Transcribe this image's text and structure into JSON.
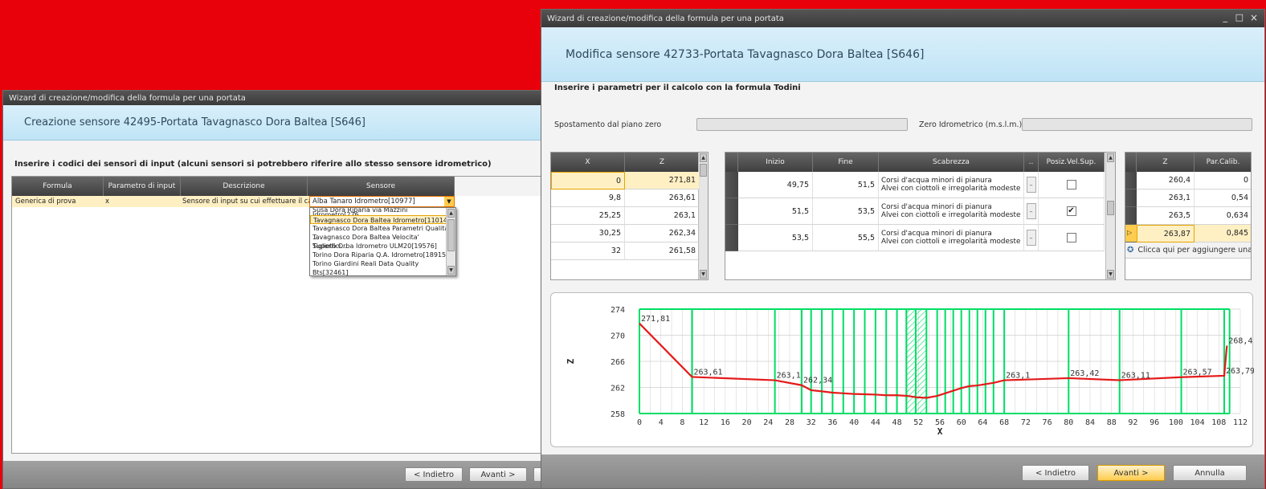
{
  "left": {
    "title": "Wizard di creazione/modifica della formula per una portata",
    "header": "Creazione sensore 42495-Portata Tavagnasco Dora Baltea [S646]",
    "instruction": "Inserire i codici dei sensori di input (alcuni sensori si potrebbero riferire allo stesso sensore idrometrico)",
    "columns": [
      "Formula",
      "Parametro di input",
      "Descrizione",
      "Sensore"
    ],
    "row": [
      "Generica di prova",
      "x",
      "Sensore di input su cui effettuare il calcolo",
      "Alba Tanaro Idrometro[10977]"
    ],
    "dropdown": [
      "Susa Dora Riparia via Mazzini Idrometro[276...",
      "Tavagnasco Dora Baltea Idrometro[11014]",
      "Tavagnasco Dora Baltea Parametri Qualita' ...",
      "Tavagnasco Dora Baltea Velocita' Superfici...",
      "Tiglieto Orba Idrometro ULM20[19576]",
      "Torino Dora Riparia Q.A. Idrometro[18915]",
      "Torino Giardini Reali Data Quality Bts[32461]"
    ],
    "back": "< Indietro",
    "next": "Avanti >"
  },
  "right": {
    "title": "Wizard di creazione/modifica della formula per una portata",
    "controls": [
      "_",
      "□",
      "×"
    ],
    "header": "Modifica sensore 42733-Portata Tavagnasco Dora Baltea [S646]",
    "instruction": "Inserire i parametri per il calcolo con la formula Todini",
    "offset_label": "Spostamento dal piano zero",
    "zero_label": "Zero Idrometrico (m.s.l.m.)",
    "xz": {
      "columns": [
        "X",
        "Z"
      ],
      "rows": [
        [
          "0",
          "271,81"
        ],
        [
          "9,8",
          "263,61"
        ],
        [
          "25,25",
          "263,1"
        ],
        [
          "30,25",
          "262,34"
        ],
        [
          "32",
          "261,58"
        ]
      ]
    },
    "rough": {
      "columns": [
        "Inizio",
        "Fine",
        "Scabrezza",
        "..",
        "Posiz.Vel.Sup."
      ],
      "rows": [
        {
          "start": "49,75",
          "end": "51,5",
          "line1": "Corsi d'acqua minori di pianura",
          "line2": "Alvei con ciottoli e irregolarità modeste",
          "check": ""
        },
        {
          "start": "51,5",
          "end": "53,5",
          "line1": "Corsi d'acqua minori di pianura",
          "line2": "Alvei con ciottoli e irregolarità modeste",
          "check": "✔"
        },
        {
          "start": "53,5",
          "end": "55,5",
          "line1": "Corsi d'acqua minori di pianura",
          "line2": "Alvei con ciottoli e irregolarità modeste",
          "check": ""
        }
      ]
    },
    "calib": {
      "columns": [
        "Z",
        "Par.Calib."
      ],
      "rows": [
        [
          "260,4",
          "0"
        ],
        [
          "263,1",
          "0,54"
        ],
        [
          "263,5",
          "0,634"
        ],
        [
          "263,87",
          "0,845"
        ]
      ],
      "add": "Clicca qui per aggiungere una"
    },
    "back": "< Indietro",
    "next": "Avanti >",
    "cancel": "Annulla"
  },
  "chart_data": {
    "type": "line",
    "xlabel": "X",
    "ylabel": "Z",
    "xlim": [
      0,
      112
    ],
    "ylim": [
      258,
      274
    ],
    "xticks": [
      0,
      4,
      8,
      12,
      16,
      20,
      24,
      28,
      32,
      36,
      40,
      44,
      48,
      52,
      56,
      60,
      64,
      68,
      72,
      76,
      80,
      84,
      88,
      92,
      96,
      100,
      104,
      108,
      112
    ],
    "yticks": [
      258,
      262,
      266,
      270,
      274
    ],
    "profile": {
      "x": [
        0,
        9.8,
        25.25,
        30.25,
        32,
        34,
        36,
        38,
        40,
        42,
        44,
        46,
        48,
        50,
        51.5,
        53.5,
        55.5,
        57,
        58.5,
        60,
        61.5,
        63,
        64.5,
        66,
        68,
        80,
        89.5,
        101,
        109,
        109.5
      ],
      "z": [
        271.81,
        263.61,
        263.1,
        262.34,
        261.58,
        261.4,
        261.2,
        261.1,
        261.0,
        260.95,
        260.9,
        260.8,
        260.8,
        260.7,
        260.5,
        260.4,
        260.7,
        261.1,
        261.5,
        261.9,
        262.2,
        262.3,
        262.5,
        262.7,
        263.1,
        263.42,
        263.11,
        263.57,
        263.79,
        268.4
      ]
    },
    "labels": [
      {
        "x": 0,
        "z": 271.81,
        "t": "271,81"
      },
      {
        "x": 9.8,
        "z": 263.61,
        "t": "263,61"
      },
      {
        "x": 25.25,
        "z": 263.1,
        "t": "263,1"
      },
      {
        "x": 30.25,
        "z": 262.34,
        "t": "262,34"
      },
      {
        "x": 68,
        "z": 263.1,
        "t": "263,1"
      },
      {
        "x": 80,
        "z": 263.42,
        "t": "263,42"
      },
      {
        "x": 89.5,
        "z": 263.11,
        "t": "263,11"
      },
      {
        "x": 101,
        "z": 263.57,
        "t": "263,57"
      },
      {
        "x": 109,
        "z": 263.79,
        "t": "263,79"
      },
      {
        "x": 109.5,
        "z": 268.4,
        "t": "268,4"
      }
    ],
    "verticals": [
      0,
      9.8,
      25.25,
      30.25,
      32,
      34,
      36,
      38,
      40,
      42,
      44,
      46,
      48,
      49.75,
      51.5,
      53.5,
      55.5,
      57,
      58.5,
      60,
      61.5,
      63,
      64.5,
      66,
      68,
      80,
      89.5,
      101,
      109
    ],
    "hatch": [
      49.75,
      53.5
    ],
    "colors": {
      "profile": "#e41a1a",
      "verticals": "#00dd66",
      "grid": "#cfcfcf"
    }
  }
}
